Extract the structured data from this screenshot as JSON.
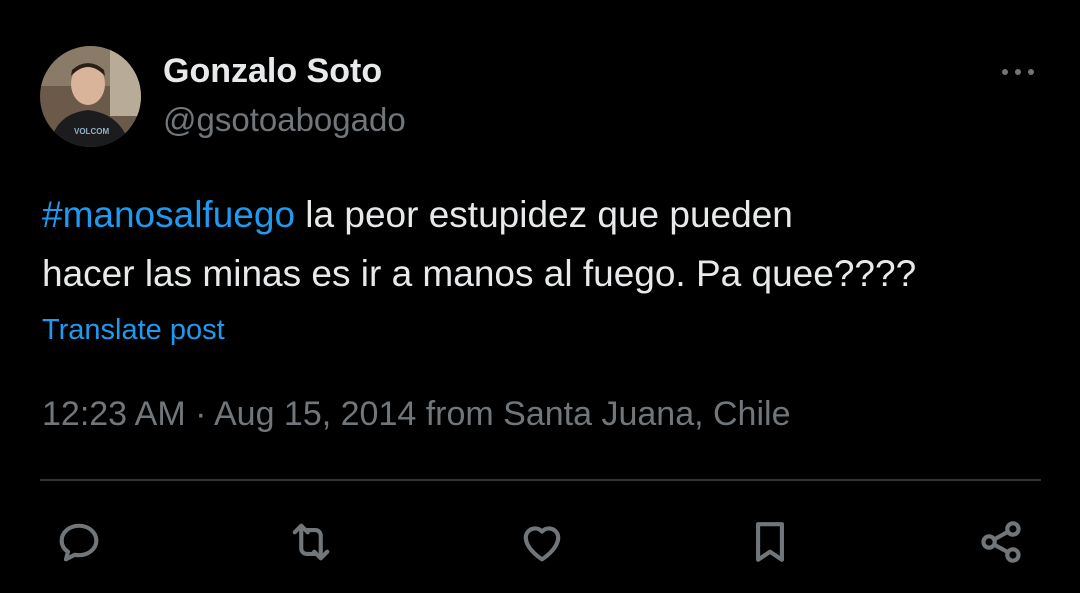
{
  "author": {
    "display_name": "Gonzalo Soto",
    "handle": "@gsotoabogado",
    "avatar_shirt_text": "VOLCOM"
  },
  "post": {
    "hashtag": "#manosalfuego",
    "text_line1_rest": " la peor estupidez que pueden",
    "text_line2": "hacer las minas es ir a manos al fuego. Pa quee????",
    "translate_label": "Translate post",
    "timestamp": "12:23 AM · Aug 15, 2014 from Santa Juana, Chile"
  },
  "icons": {
    "more": "more-horizontal-icon",
    "reply": "reply-icon",
    "repost": "repost-icon",
    "like": "like-icon",
    "bookmark": "bookmark-icon",
    "share": "share-icon"
  },
  "colors": {
    "background": "#000000",
    "text": "#e7e9ea",
    "muted": "#71767b",
    "accent": "#1d9bf0",
    "divider": "#2f3336"
  }
}
